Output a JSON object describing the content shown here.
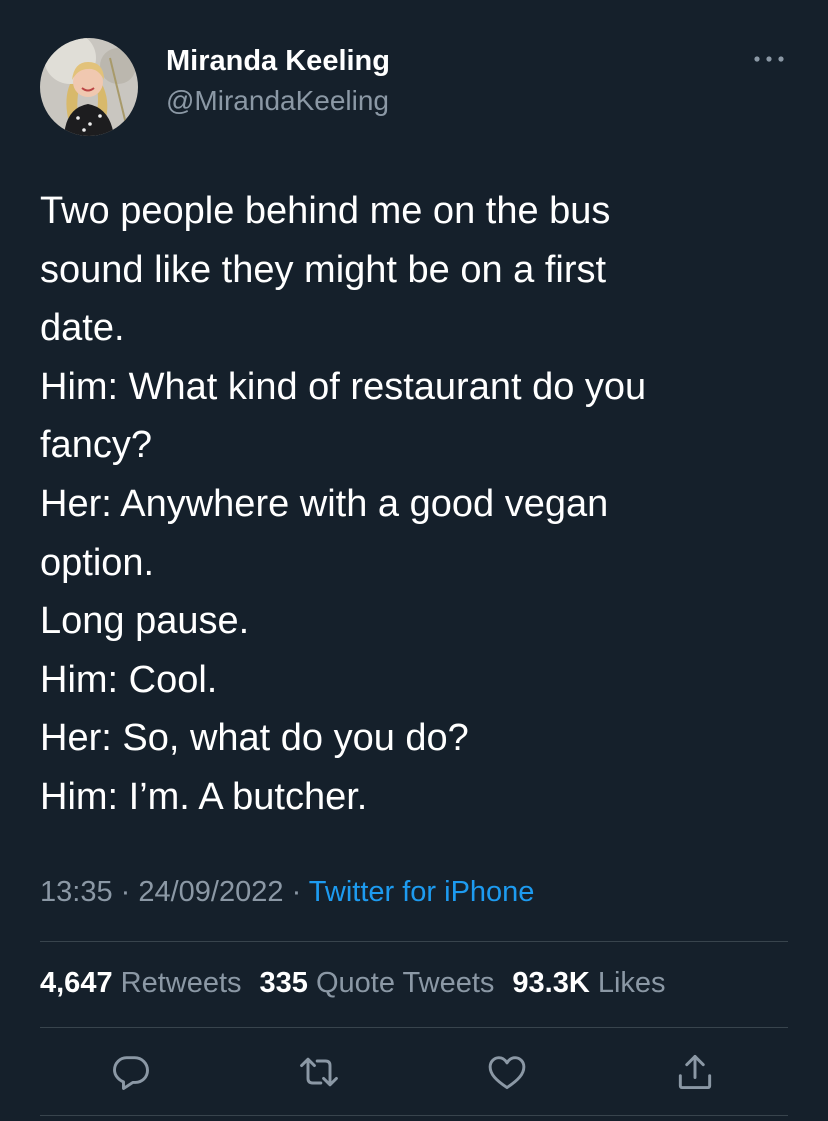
{
  "author": {
    "name": "Miranda Keeling",
    "handle": "@MirandaKeeling"
  },
  "tweet": {
    "lines": [
      "Two people behind me on the bus",
      "sound like they might be on a first",
      "date.",
      "Him: What kind of restaurant do you",
      "fancy?",
      "Her: Anywhere with a good vegan",
      "option.",
      "Long pause.",
      "Him: Cool.",
      "Her: So, what do you do?",
      "Him: I’m. A butcher."
    ]
  },
  "meta": {
    "time": "13:35",
    "separator": " · ",
    "date": "24/09/2022",
    "source": "Twitter for iPhone"
  },
  "stats": {
    "retweets_count": "4,647",
    "retweets_label": "Retweets",
    "quotes_count": "335",
    "quotes_label": "Quote Tweets",
    "likes_count": "93.3K",
    "likes_label": "Likes"
  },
  "actions": [
    "reply-icon",
    "retweet-icon",
    "like-icon",
    "share-icon"
  ],
  "colors": {
    "background": "#15202b",
    "secondary_text": "#8b98a5",
    "link": "#1d9bf0",
    "divider": "#38444d"
  }
}
